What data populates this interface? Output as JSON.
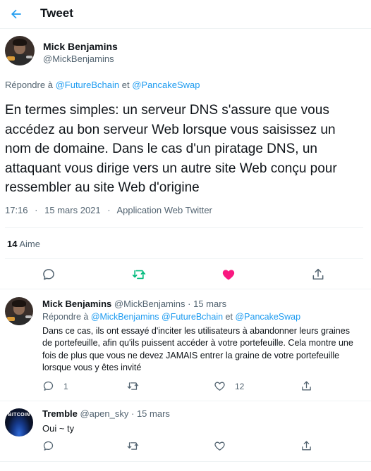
{
  "header": {
    "title": "Tweet"
  },
  "main_tweet": {
    "author_name": "Mick Benjamins",
    "author_handle": "@MickBenjamins",
    "reply_prefix": "Répondre à",
    "reply_mention_1": "@FutureBchain",
    "reply_conj": "et",
    "reply_mention_2": "@PancakeSwap",
    "text": "En termes simples: un serveur DNS s'assure que vous accédez au bon serveur Web lorsque vous saisissez un nom de domaine. Dans le cas d'un piratage DNS, un attaquant vous dirige vers un autre site Web conçu pour ressembler au site Web d'origine",
    "time": "17:16",
    "date": "15 mars 2021",
    "separator": "·",
    "source": "Application Web Twitter",
    "likes_count": "14",
    "likes_label": "Aime"
  },
  "replies": [
    {
      "author_name": "Mick Benjamins",
      "author_handle": "@MickBenjamins",
      "separator": "·",
      "date": "15 mars",
      "reply_prefix": "Répondre à",
      "reply_mentions": "@MickBenjamins @FutureBchain",
      "reply_conj": "et",
      "reply_mention_last": "@PancakeSwap",
      "text": "Dans ce cas, ils ont essayé d'inciter les utilisateurs à abandonner leurs graines de portefeuille, afin qu'ils puissent accéder à votre portefeuille. Cela montre une fois de plus que vous ne devez JAMAIS entrer la graine de votre portefeuille lorsque vous y êtes invité",
      "reply_count": "1",
      "retweet_count": "",
      "like_count": "12"
    },
    {
      "author_name": "Tremble",
      "author_handle": "@apen_sky",
      "separator": "·",
      "date": "15 mars",
      "avatar_text": "BITCOIN",
      "text": "Oui ~ ty"
    }
  ],
  "colors": {
    "accent": "#1d9bf0",
    "retweet": "#00ba7c",
    "like": "#f91880",
    "muted": "#536471"
  }
}
